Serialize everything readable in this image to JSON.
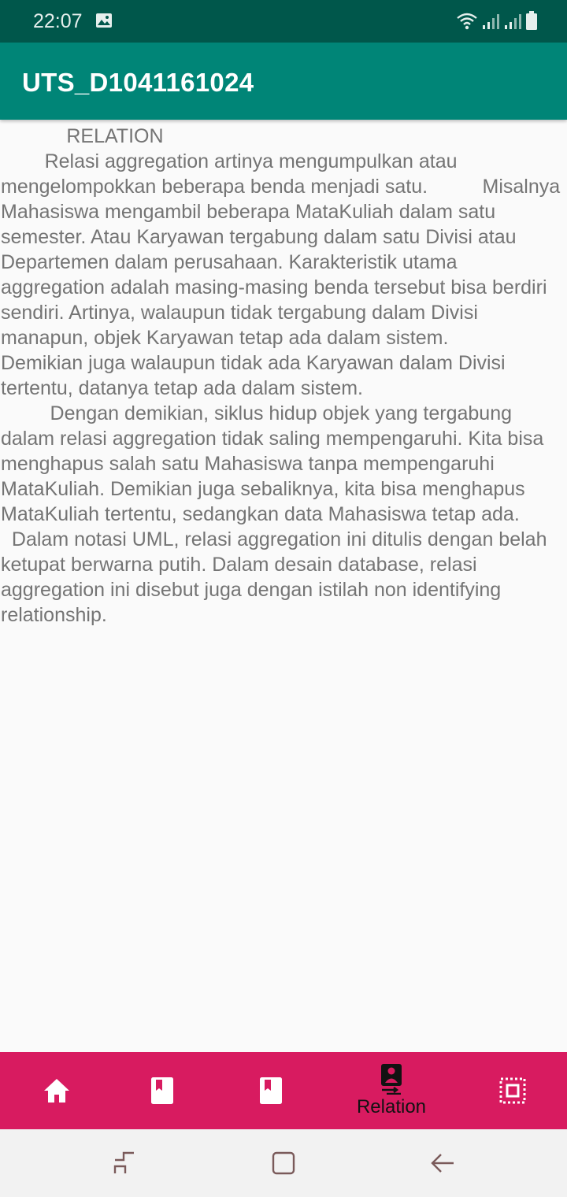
{
  "status_bar": {
    "time": "22:07",
    "icons": [
      "image-icon",
      "wifi-icon",
      "signal-icon",
      "signal-icon",
      "battery-icon"
    ]
  },
  "app_bar": {
    "title": "UTS_D1041161024"
  },
  "content": {
    "paragraphs": [
      "            RELATION\n        Relasi aggregation artinya mengumpulkan atau mengelompokkan beberapa benda menjadi satu.          Misalnya Mahasiswa mengambil beberapa MataKuliah dalam satu semester. Atau Karyawan tergabung dalam satu Divisi atau Departemen dalam perusahaan. Karakteristik utama          aggregation adalah masing-masing benda tersebut bisa berdiri sendiri. Artinya, walaupun tidak tergabung dalam Divisi manapun, objek Karyawan tetap ada dalam sistem.          Demikian juga walaupun tidak ada Karyawan dalam Divisi tertentu, datanya tetap ada dalam sistem.",
      "         Dengan demikian, siklus hidup objek yang tergabung dalam relasi aggregation tidak saling mempengaruhi. Kita bisa menghapus salah satu Mahasiswa tanpa mempengaruhi MataKuliah. Demikian juga sebaliknya, kita bisa menghapus MataKuliah tertentu, sedangkan data Mahasiswa tetap ada.",
      "  Dalam notasi UML, relasi aggregation ini ditulis dengan belah ketupat berwarna putih. Dalam desain database, relasi aggregation ini disebut juga dengan istilah non identifying relationship."
    ]
  },
  "bottom_nav": {
    "items": [
      {
        "icon": "home-icon",
        "label": ""
      },
      {
        "icon": "book-icon",
        "label": ""
      },
      {
        "icon": "book-icon",
        "label": ""
      },
      {
        "icon": "contact-transfer-icon",
        "label": "Relation"
      },
      {
        "icon": "select-all-icon",
        "label": ""
      }
    ],
    "active_index": 3
  },
  "system_nav": {
    "icons": [
      "recent-apps-icon",
      "home-square-icon",
      "back-arrow-icon"
    ]
  },
  "colors": {
    "status_bar": "#00574b",
    "app_bar": "#008577",
    "bottom_nav": "#d81b60",
    "content_text": "#747474",
    "background": "#fafafa"
  }
}
